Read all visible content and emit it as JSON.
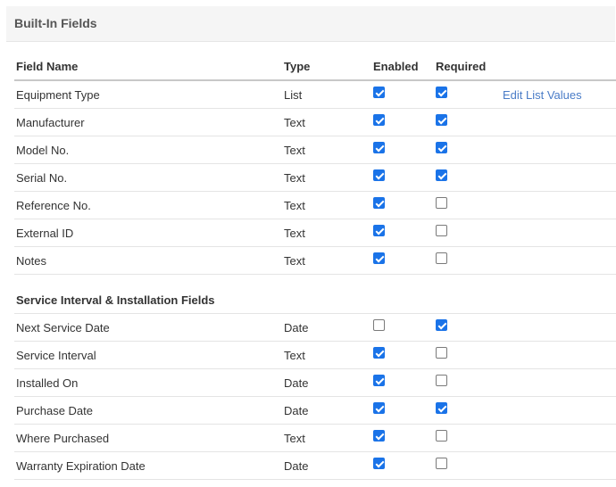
{
  "panel": {
    "title": "Built-In Fields"
  },
  "columns": {
    "name": "Field Name",
    "type": "Type",
    "enabled": "Enabled",
    "required": "Required"
  },
  "colors": {
    "accent_checkbox": "#1a73e8",
    "link": "#4a7cc7",
    "header_bg": "#f5f5f5"
  },
  "builtin_rows": [
    {
      "name": "Equipment Type",
      "type": "List",
      "enabled": true,
      "required": true,
      "action": "Edit List Values"
    },
    {
      "name": "Manufacturer",
      "type": "Text",
      "enabled": true,
      "required": true
    },
    {
      "name": "Model No.",
      "type": "Text",
      "enabled": true,
      "required": true
    },
    {
      "name": "Serial No.",
      "type": "Text",
      "enabled": true,
      "required": true
    },
    {
      "name": "Reference No.",
      "type": "Text",
      "enabled": true,
      "required": false
    },
    {
      "name": "External ID",
      "type": "Text",
      "enabled": true,
      "required": false
    },
    {
      "name": "Notes",
      "type": "Text",
      "enabled": true,
      "required": false
    }
  ],
  "service_section": {
    "title": "Service Interval & Installation Fields",
    "rows": [
      {
        "name": "Next Service Date",
        "type": "Date",
        "enabled": false,
        "required": true
      },
      {
        "name": "Service Interval",
        "type": "Text",
        "enabled": true,
        "required": false
      },
      {
        "name": "Installed On",
        "type": "Date",
        "enabled": true,
        "required": false
      },
      {
        "name": "Purchase Date",
        "type": "Date",
        "enabled": true,
        "required": true
      },
      {
        "name": "Where Purchased",
        "type": "Text",
        "enabled": true,
        "required": false
      },
      {
        "name": "Warranty Expiration Date",
        "type": "Date",
        "enabled": true,
        "required": false
      }
    ]
  }
}
